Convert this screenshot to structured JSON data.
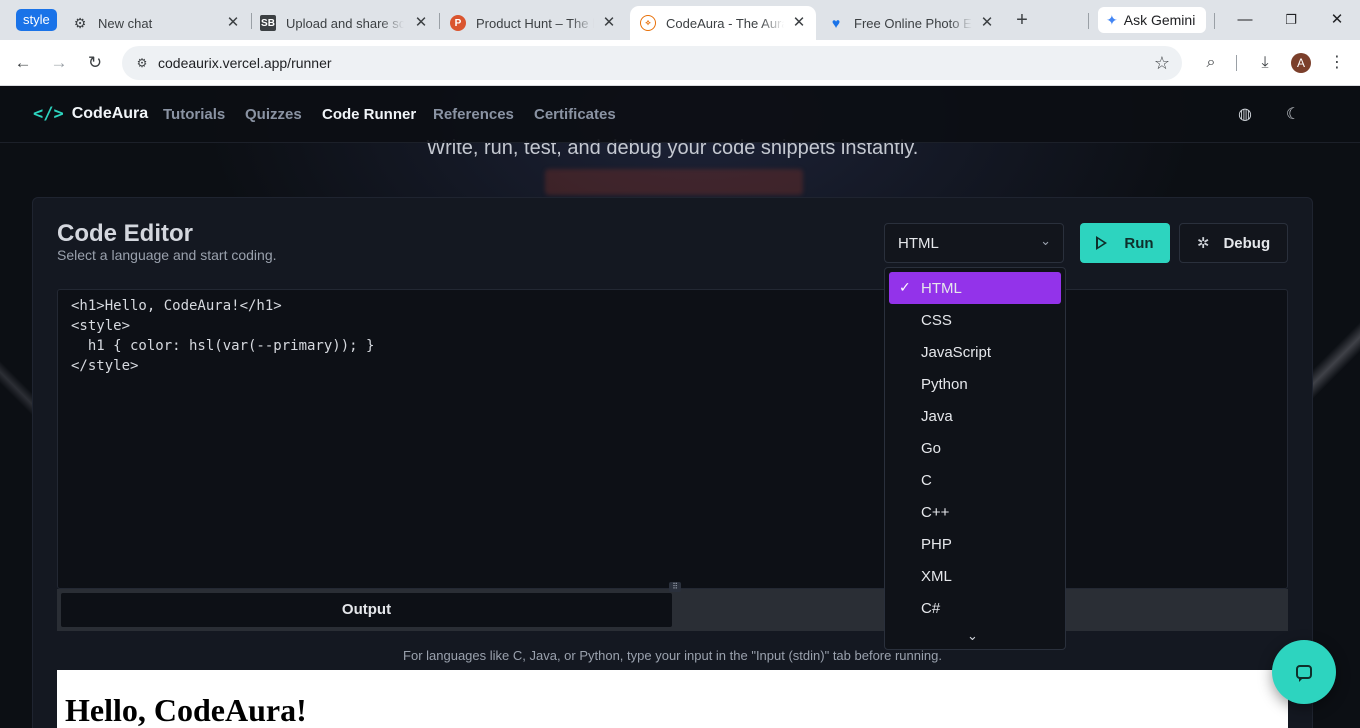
{
  "browser": {
    "style_chip": "style",
    "tabs": [
      {
        "title": "New chat",
        "favicon": "openai-icon"
      },
      {
        "title": "Upload and share scre",
        "favicon": "SB"
      },
      {
        "title": "Product Hunt – The be",
        "favicon": "P"
      },
      {
        "title": "CodeAura - The Aura c",
        "favicon": "codeaura-icon"
      },
      {
        "title": "Free Online Photo Edit",
        "favicon": "heart-icon"
      }
    ],
    "active_tab": 3,
    "gemini_label": "Ask Gemini",
    "url": "codeaurix.vercel.app/runner",
    "profile_initial": "A"
  },
  "site": {
    "brand": "CodeAura",
    "brand_mark": "</>",
    "nav": [
      "Tutorials",
      "Quizzes",
      "Code Runner",
      "References",
      "Certificates"
    ],
    "active_nav": "Code Runner",
    "subtitle": "Write, run, test, and debug your code snippets instantly."
  },
  "editor": {
    "title": "Code Editor",
    "subtitle": "Select a language and start coding.",
    "selected_language": "HTML",
    "run_label": "Run",
    "debug_label": "Debug",
    "code_lines": [
      "<h1>Hello, CodeAura!</h1>",
      "<style>",
      "  h1 { color: hsl(var(--primary)); }",
      "</style>"
    ],
    "output_tab": "Output",
    "hint": "For languages like C, Java, or Python, type your input in the \"Input (stdin)\" tab before running."
  },
  "dropdown": {
    "options": [
      "HTML",
      "CSS",
      "JavaScript",
      "Python",
      "Java",
      "Go",
      "C",
      "C++",
      "PHP",
      "XML",
      "C#"
    ],
    "selected": "HTML"
  },
  "output": {
    "h1": "Hello, CodeAura!"
  },
  "colors": {
    "accent": "#2dd4bf",
    "selection": "#9333ea",
    "background": "#0c0f14"
  }
}
